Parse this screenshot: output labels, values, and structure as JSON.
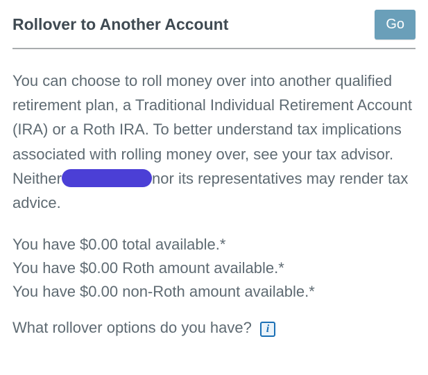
{
  "header": {
    "title": "Rollover to Another Account",
    "go_label": "Go"
  },
  "intro": {
    "part1": "You can choose to roll money over into another qualified retirement plan, a Traditional Individual Retirement Account (IRA) or a Roth IRA. To better understand tax implications associated with rolling money over, see your tax advisor. Neither ",
    "part2": "nor its representatives may render tax advice."
  },
  "availability": {
    "total": "You have $0.00 total available.*",
    "roth": "You have $0.00 Roth amount available.*",
    "non_roth": "You have $0.00 non-Roth amount available.*"
  },
  "question": "What rollover options do you have?"
}
